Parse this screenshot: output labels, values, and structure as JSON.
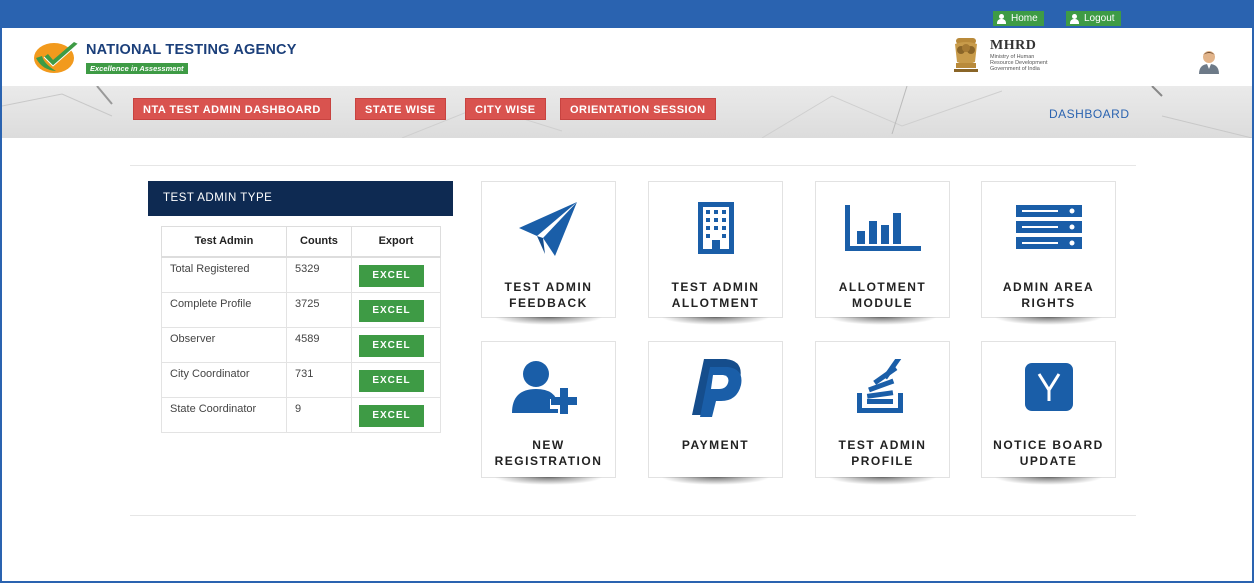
{
  "topbar": {
    "home_label": "Home",
    "logout_label": "Logout"
  },
  "header": {
    "brand_name": "NATIONAL TESTING AGENCY",
    "brand_tagline": "Excellence in Assessment",
    "ministry_title": "MHRD",
    "ministry_line1": "Ministry of Human",
    "ministry_line2": "Resource Development",
    "ministry_line3": "Government of India"
  },
  "nav": {
    "items": [
      {
        "label": "NTA TEST ADMIN DASHBOARD"
      },
      {
        "label": "STATE WISE"
      },
      {
        "label": "CITY WISE"
      },
      {
        "label": "ORIENTATION SESSION"
      }
    ],
    "dashboard_label": "DASHBOARD"
  },
  "panel": {
    "title": "TEST ADMIN TYPE",
    "columns": [
      "Test Admin",
      "Counts",
      "Export"
    ],
    "rows": [
      {
        "type": "Total Registered",
        "count": "5329",
        "export": "EXCEL"
      },
      {
        "type": "Complete Profile",
        "count": "3725",
        "export": "EXCEL"
      },
      {
        "type": "Observer",
        "count": "4589",
        "export": "EXCEL"
      },
      {
        "type": "City Coordinator",
        "count": "731",
        "export": "EXCEL"
      },
      {
        "type": "State Coordinator",
        "count": "9",
        "export": "EXCEL"
      }
    ]
  },
  "tiles": [
    {
      "label": "TEST ADMIN\nFEEDBACK",
      "icon": "paper-plane-icon"
    },
    {
      "label": "TEST ADMIN\nALLOTMENT",
      "icon": "building-icon"
    },
    {
      "label": "ALLOTMENT\nMODULE",
      "icon": "bar-chart-icon"
    },
    {
      "label": "ADMIN AREA\nRIGHTS",
      "icon": "server-icon"
    },
    {
      "label": "NEW\nREGISTRATION",
      "icon": "user-plus-icon"
    },
    {
      "label": "PAYMENT",
      "icon": "paypal-icon"
    },
    {
      "label": "TEST ADMIN\nPROFILE",
      "icon": "stack-overflow-icon"
    },
    {
      "label": "NOTICE BOARD\nUPDATE",
      "icon": "y-square-icon"
    }
  ],
  "colors": {
    "topbar": "#2a63b0",
    "nav_button": "#d9534f",
    "excel_button": "#3e9b45",
    "panel_header": "#0e2a52",
    "icon_blue": "#1a5ea8"
  }
}
